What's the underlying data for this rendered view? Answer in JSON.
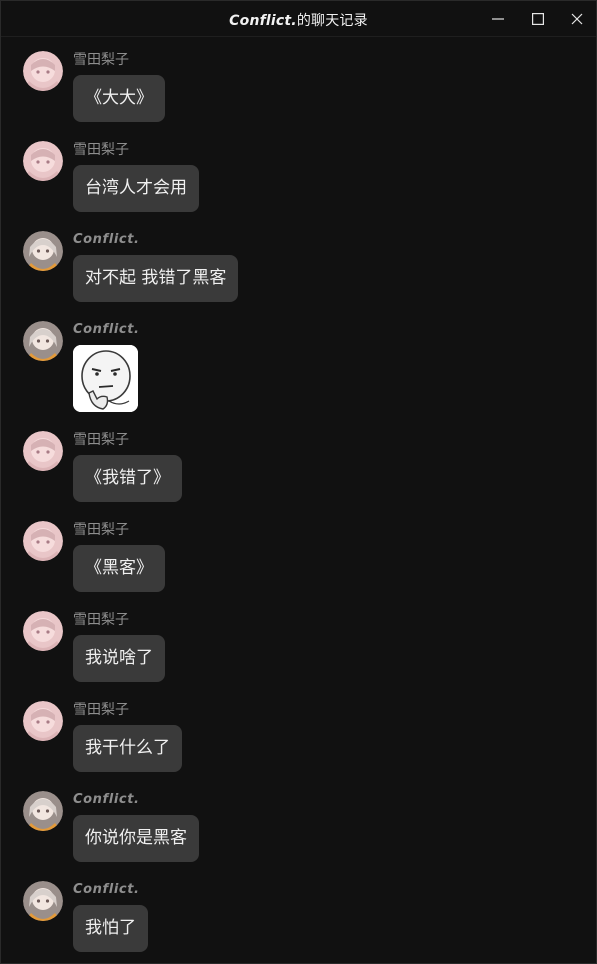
{
  "window": {
    "title_name": "Conflict.",
    "title_suffix": "的聊天记录",
    "minimize_icon": "minimize-icon",
    "maximize_icon": "maximize-icon",
    "close_icon": "close-icon"
  },
  "colors": {
    "background": "#111111",
    "bubble": "#3a3a3a",
    "text": "#f0f0f0",
    "sender": "#8e8e8e"
  },
  "messages": [
    {
      "sender": "雪田梨子",
      "text": "《大大》"
    },
    {
      "sender": "雪田梨子",
      "text": "台湾人才会用"
    },
    {
      "sender": "Conflict.",
      "text": "对不起 我错了黑客"
    },
    {
      "sender": "Conflict.",
      "sticker": "thinking-face-sticker"
    },
    {
      "sender": "雪田梨子",
      "text": "《我错了》"
    },
    {
      "sender": "雪田梨子",
      "text": "《黑客》"
    },
    {
      "sender": "雪田梨子",
      "text": "我说啥了"
    },
    {
      "sender": "雪田梨子",
      "text": "我干什么了"
    },
    {
      "sender": "Conflict.",
      "text": "你说你是黑客"
    },
    {
      "sender": "Conflict.",
      "text": "我怕了"
    }
  ]
}
